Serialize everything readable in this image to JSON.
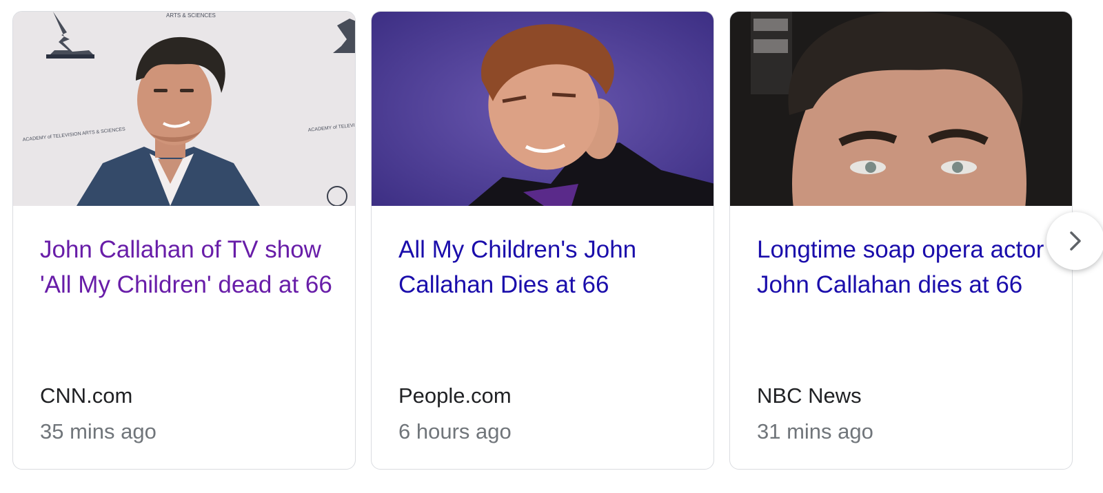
{
  "cards": [
    {
      "headline": "John Callahan of TV show 'All My Children' dead at 66",
      "source": "CNN.com",
      "time": "35 mins ago",
      "headline_color": "#681da8"
    },
    {
      "headline": "All My Children's John Callahan Dies at 66",
      "source": "People.com",
      "time": "6 hours ago",
      "headline_color": "#1a0dab"
    },
    {
      "headline": "Longtime soap opera actor John Callahan dies at 66",
      "source": "NBC News",
      "time": "31 mins ago",
      "headline_color": "#1a0dab"
    }
  ],
  "thumbnails": [
    {
      "backdrop_text_top": "ARTS & SCIENCES",
      "backdrop_text_left": "ACADEMY of TELEVISION ARTS & SCIENCES",
      "backdrop_text_right": "ACADEMY of TELEVISION ARTS & SC"
    },
    {},
    {}
  ],
  "colors": {
    "visited_link": "#681da8",
    "link": "#1a0dab",
    "source_text": "#202124",
    "time_text": "#70757a",
    "card_border": "#dadce0"
  },
  "icons": {
    "next": "chevron-right-icon"
  }
}
